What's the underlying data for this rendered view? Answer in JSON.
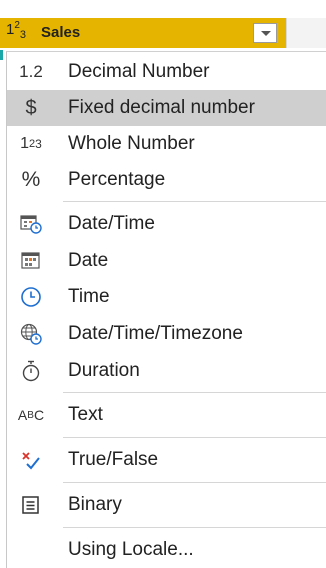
{
  "column": {
    "type_icon": "whole-number",
    "name": "Sales",
    "header_color": "#e4b400"
  },
  "menu": {
    "items": [
      {
        "label": "Decimal Number",
        "icon": "decimal-icon",
        "glyph": "1.2"
      },
      {
        "label": "Fixed decimal number",
        "icon": "dollar-icon",
        "glyph": "$",
        "selected": true
      },
      {
        "label": "Whole Number",
        "icon": "whole-number-icon"
      },
      {
        "label": "Percentage",
        "icon": "percent-icon",
        "glyph": "%"
      },
      {
        "label": "Date/Time",
        "icon": "datetime-icon"
      },
      {
        "label": "Date",
        "icon": "calendar-icon"
      },
      {
        "label": "Time",
        "icon": "clock-icon"
      },
      {
        "label": "Date/Time/Timezone",
        "icon": "globe-clock-icon"
      },
      {
        "label": "Duration",
        "icon": "stopwatch-icon"
      },
      {
        "label": "Text",
        "icon": "text-abc-icon"
      },
      {
        "label": "True/False",
        "icon": "true-false-icon"
      },
      {
        "label": "Binary",
        "icon": "binary-doc-icon"
      },
      {
        "label": "Using Locale...",
        "icon": ""
      }
    ],
    "selected_color": "#cfcfcf"
  }
}
